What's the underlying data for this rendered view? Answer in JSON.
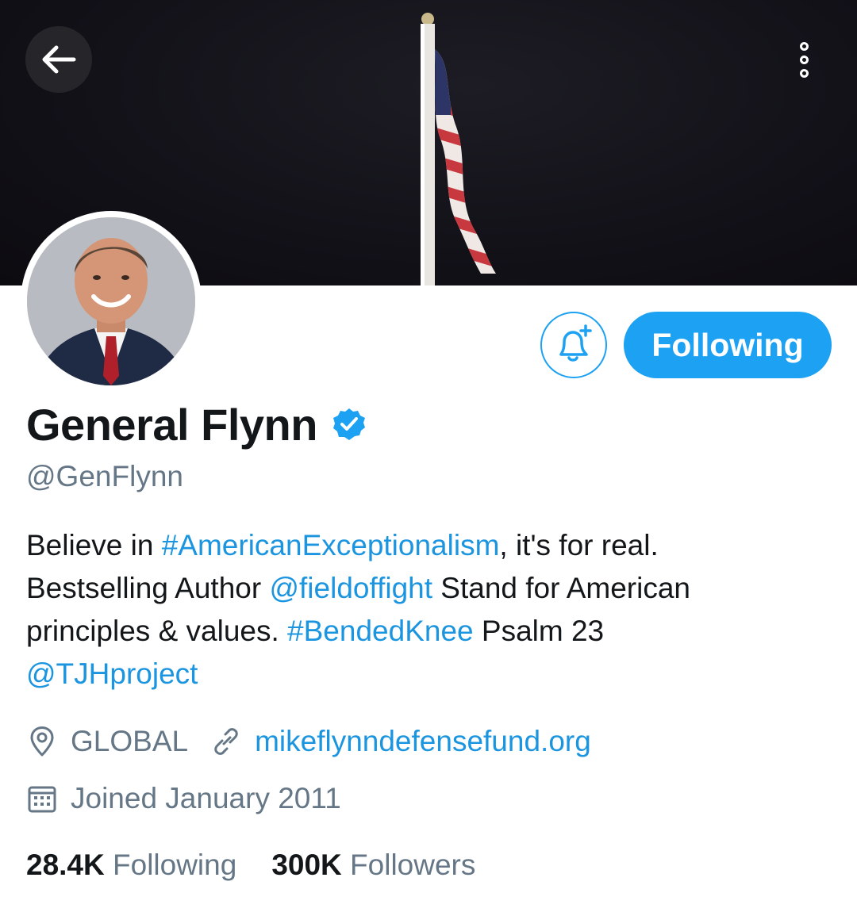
{
  "header": {
    "back_icon": "arrow-left-icon",
    "more_icon": "more-vertical-icon"
  },
  "profile": {
    "display_name": "General Flynn",
    "verified_icon": "verified-badge-icon",
    "handle": "@GenFlynn",
    "bio": {
      "line1_prefix": "Believe in ",
      "line1_hashtag": "#AmericanExceptionalism",
      "line1_suffix": ", it's for real.",
      "line2_prefix": "Bestselling Author ",
      "line2_mention": "@fieldoffight",
      "line2_suffix": " Stand for American",
      "line3_prefix": "principles & values. ",
      "line3_hashtag": "#BendedKnee",
      "line3_suffix": " Psalm 23",
      "line4_mention": "@TJHproject"
    },
    "location": "GLOBAL",
    "website": "mikeflynndefensefund.org",
    "joined": "Joined January 2011",
    "following_count": "28.4K",
    "following_label": "Following",
    "followers_count": "300K",
    "followers_label": "Followers"
  },
  "actions": {
    "notify_icon": "bell-plus-icon",
    "following_button": "Following"
  },
  "colors": {
    "accent": "#1da1f2",
    "link": "#1b95e0",
    "secondary_text": "#657786",
    "primary_text": "#14171a"
  }
}
